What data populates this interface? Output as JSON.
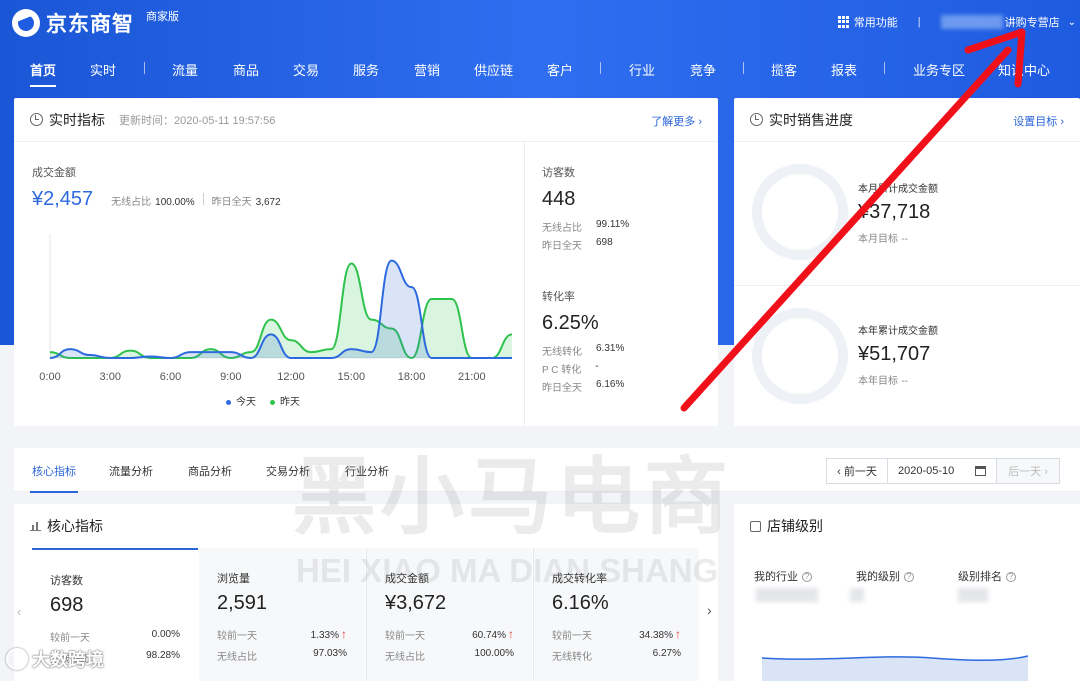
{
  "header": {
    "logo_text": "京东商智",
    "logo_sub": "商家版",
    "common_functions": "常用功能",
    "divider": "|",
    "store_name": "讲购专营店"
  },
  "nav": {
    "items": [
      {
        "label": "首页",
        "active": true
      },
      {
        "label": "实时"
      },
      {
        "label": "流量"
      },
      {
        "label": "商品"
      },
      {
        "label": "交易"
      },
      {
        "label": "服务"
      },
      {
        "label": "营销"
      },
      {
        "label": "供应链"
      },
      {
        "label": "客户"
      },
      {
        "label": "行业"
      },
      {
        "label": "竞争"
      },
      {
        "label": "揽客"
      },
      {
        "label": "报表"
      },
      {
        "label": "业务专区"
      },
      {
        "label": "知识中心"
      }
    ]
  },
  "realtime": {
    "title": "实时指标",
    "update_time": "更新时间：2020-05-11 19:57:56",
    "more_link": "了解更多 ›",
    "sales": {
      "label": "成交金额",
      "value": "¥2,457",
      "wireless_label": "无线占比",
      "wireless_value": "100.00%",
      "yesterday_label": "昨日全天",
      "yesterday_value": "3,672"
    },
    "visitors": {
      "label": "访客数",
      "value": "448",
      "wireless_label": "无线占比",
      "wireless_value": "99.11%",
      "yesterday_label": "昨日全天",
      "yesterday_value": "698"
    },
    "conversion": {
      "label": "转化率",
      "value": "6.25%",
      "wireless_label": "无线转化",
      "wireless_value": "6.31%",
      "pc_label": "P C 转化",
      "pc_value": "-",
      "yesterday_label": "昨日全天",
      "yesterday_value": "6.16%"
    },
    "legend_today": "今天",
    "legend_yesterday": "昨天"
  },
  "chart_data": {
    "type": "area",
    "x_ticks": [
      "0:00",
      "3:00",
      "6:00",
      "9:00",
      "12:00",
      "15:00",
      "18:00",
      "21:00"
    ],
    "x": [
      0,
      1,
      2,
      3,
      4,
      5,
      6,
      7,
      8,
      9,
      10,
      11,
      12,
      13,
      14,
      15,
      16,
      17,
      18,
      19,
      20,
      21,
      22,
      23
    ],
    "series": [
      {
        "name": "今天",
        "color": "#2d6adf",
        "values": [
          0,
          30,
          10,
          0,
          0,
          5,
          0,
          20,
          20,
          20,
          0,
          80,
          0,
          0,
          0,
          30,
          20,
          330,
          240,
          0,
          0,
          0,
          0,
          0
        ]
      },
      {
        "name": "昨天",
        "color": "#2fc34e",
        "values": [
          20,
          0,
          0,
          0,
          25,
          0,
          0,
          0,
          30,
          0,
          20,
          130,
          60,
          20,
          30,
          320,
          130,
          100,
          0,
          200,
          200,
          0,
          0,
          80
        ]
      }
    ],
    "ylim": [
      0,
      420
    ],
    "grid": false,
    "legend_position": "bottom"
  },
  "sales_progress": {
    "title": "实时销售进度",
    "link": "设置目标 ›",
    "month_label": "本月累计成交金额",
    "month_value": "¥37,718",
    "month_target_label": "本月目标",
    "month_target_value": "--",
    "year_label": "本年累计成交金额",
    "year_value": "¥51,707",
    "year_target_label": "本年目标",
    "year_target_value": "--"
  },
  "tabs": {
    "items": [
      "核心指标",
      "流量分析",
      "商品分析",
      "交易分析",
      "行业分析"
    ],
    "prev_day": "‹ 前一天",
    "date": "2020-05-10",
    "next_day": "后一天 ›"
  },
  "core": {
    "title": "核心指标",
    "boxes": [
      {
        "title": "访客数",
        "value": "698",
        "row1_label": "较前一天",
        "row1_value": "0.00%",
        "row1_up": "",
        "row2_label": "无线占比",
        "row2_value": "98.28%"
      },
      {
        "title": "浏览量",
        "value": "2,591",
        "row1_label": "较前一天",
        "row1_value": "1.33%",
        "row1_up": "↑",
        "row2_label": "无线占比",
        "row2_value": "97.03%"
      },
      {
        "title": "成交金额",
        "value": "¥3,672",
        "row1_label": "较前一天",
        "row1_value": "60.74%",
        "row1_up": "↑",
        "row2_label": "无线占比",
        "row2_value": "100.00%"
      },
      {
        "title": "成交转化率",
        "value": "6.16%",
        "row1_label": "较前一天",
        "row1_value": "34.38%",
        "row1_up": "↑",
        "row2_label": "无线转化",
        "row2_value": "6.27%"
      }
    ]
  },
  "store_level": {
    "title": "店铺级别",
    "my_industry": "我的行业",
    "my_level": "我的级别",
    "level_rank": "级别排名"
  },
  "watermark": {
    "main": "黑小马电商",
    "sub": "HEI XIAO MA DIAN SHANG",
    "corner": "大数跨境"
  }
}
